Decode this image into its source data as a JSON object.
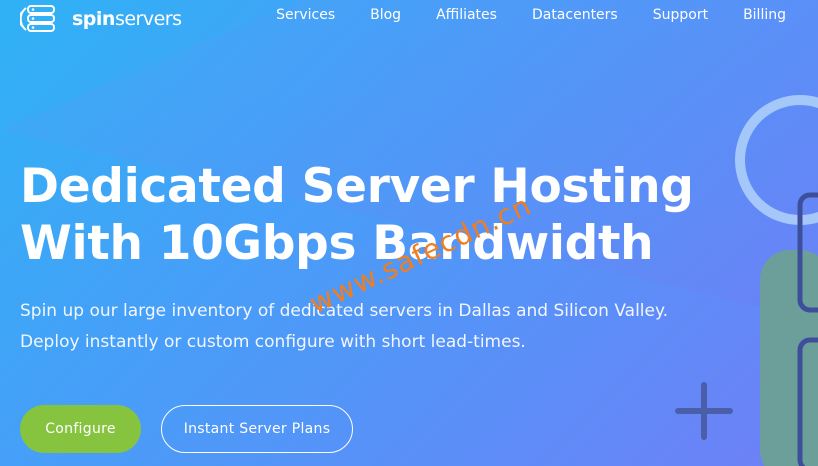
{
  "brand": {
    "bold": "spin",
    "light": "servers"
  },
  "nav": {
    "items": [
      {
        "label": "Services"
      },
      {
        "label": "Blog"
      },
      {
        "label": "Affiliates"
      },
      {
        "label": "Datacenters"
      },
      {
        "label": "Support"
      },
      {
        "label": "Billing"
      }
    ]
  },
  "hero": {
    "title_line1": "Dedicated Server Hosting",
    "title_line2": "With 10Gbps Bandwidth",
    "subtitle_line1": "Spin up our large inventory of dedicated servers in Dallas and Silicon Valley.",
    "subtitle_line2": "Deploy instantly or custom configure with short lead-times."
  },
  "buttons": {
    "configure": "Configure",
    "plans": "Instant Server Plans"
  },
  "watermark": "www.safecdn.cn",
  "colors": {
    "accent": "#86c440",
    "watermark": "#f07e1e",
    "bg_start": "#2fb2f5",
    "bg_end": "#6f7ff7"
  }
}
